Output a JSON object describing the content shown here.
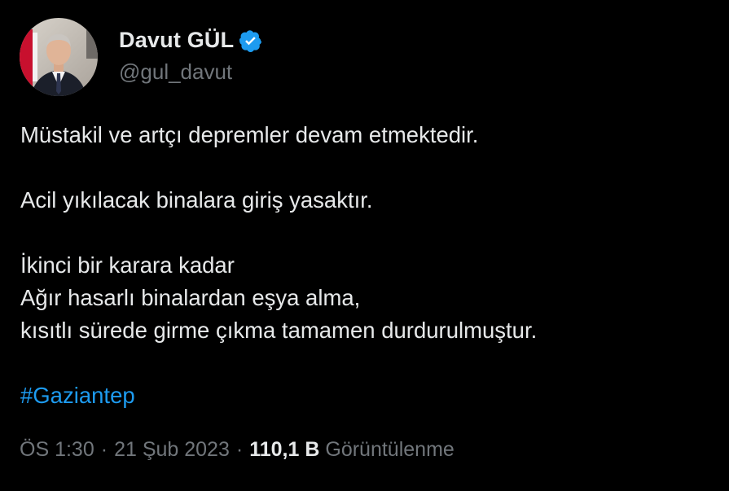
{
  "author": {
    "display_name": "Davut GÜL",
    "handle": "@gul_davut",
    "avatar_icon": "profile-photo",
    "verified_icon": "verified-badge-icon",
    "verified_color": "#1d9bf0"
  },
  "tweet": {
    "lines": [
      "Müstakil ve artçı depremler devam etmektedir.",
      "Acil yıkılacak binalara giriş yasaktır.",
      "İkinci bir karara kadar",
      "Ağır hasarlı binalardan eşya alma,",
      "kısıtlı sürede girme çıkma tamamen durdurulmuştur."
    ],
    "hashtag": "#Gaziantep"
  },
  "meta": {
    "time": "ÖS 1:30",
    "separator": "·",
    "date": "21 Şub 2023",
    "views_count": "110,1 B",
    "views_label": "Görüntülenme"
  },
  "colors": {
    "background": "#000000",
    "text": "#e7e9ea",
    "secondary": "#71767b",
    "link": "#1d9bf0"
  }
}
